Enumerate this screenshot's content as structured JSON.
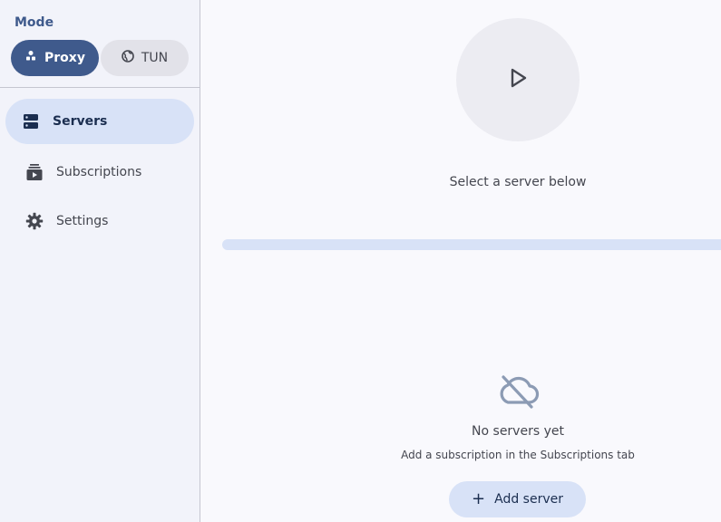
{
  "sidebar": {
    "mode_label": "Mode",
    "modes": [
      {
        "label": "Proxy",
        "icon": "proxy-icon",
        "selected": true
      },
      {
        "label": "TUN",
        "icon": "globe-icon",
        "selected": false
      }
    ],
    "nav": [
      {
        "label": "Servers",
        "icon": "servers-icon",
        "active": true
      },
      {
        "label": "Subscriptions",
        "icon": "subscriptions-icon",
        "active": false
      },
      {
        "label": "Settings",
        "icon": "gear-icon",
        "active": false
      }
    ]
  },
  "main": {
    "status_text": "Select a server below",
    "empty_title": "No servers yet",
    "empty_subtitle": "Add a subscription in the Subscriptions tab",
    "add_button_label": "Add server"
  },
  "colors": {
    "accent": "#3f5a8c",
    "accent_container": "#d8e2f7",
    "surface": "#f9f9fd"
  }
}
